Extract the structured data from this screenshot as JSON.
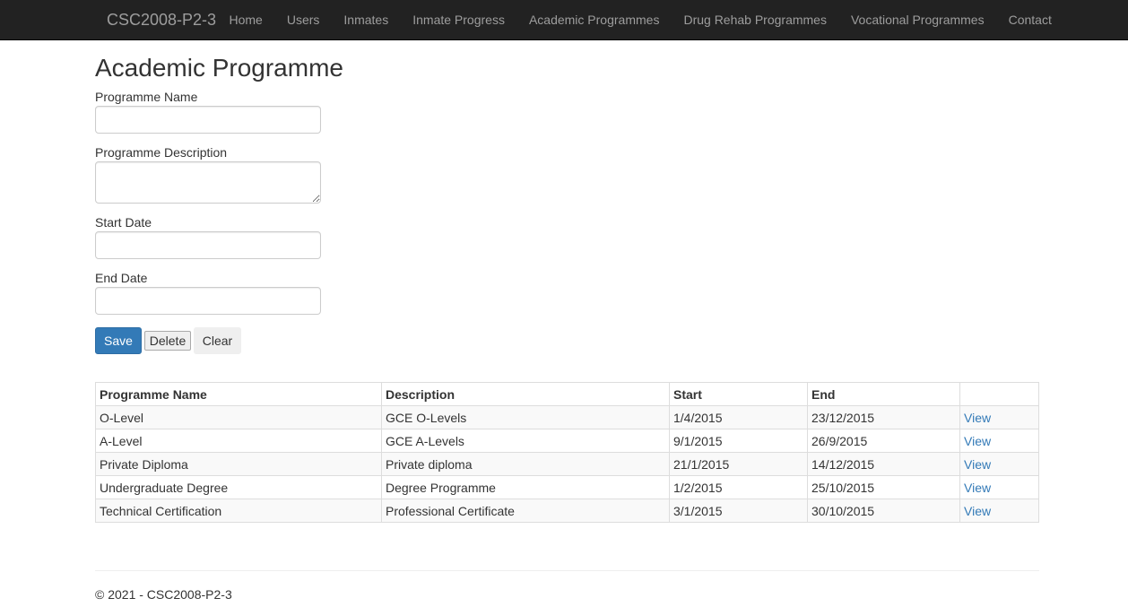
{
  "navbar": {
    "brand": "CSC2008-P2-3",
    "items": [
      {
        "label": "Home"
      },
      {
        "label": "Users"
      },
      {
        "label": "Inmates"
      },
      {
        "label": "Inmate Progress"
      },
      {
        "label": "Academic Programmes"
      },
      {
        "label": "Drug Rehab Programmes"
      },
      {
        "label": "Vocational Programmes"
      },
      {
        "label": "Contact"
      }
    ]
  },
  "page": {
    "title": "Academic Programme"
  },
  "form": {
    "name_label": "Programme Name",
    "name_value": "",
    "description_label": "Programme Description",
    "description_value": "",
    "start_label": "Start Date",
    "start_value": "",
    "end_label": "End Date",
    "end_value": "",
    "save_label": "Save",
    "delete_label": "Delete",
    "clear_label": "Clear"
  },
  "table": {
    "headers": [
      "Programme Name",
      "Description",
      "Start",
      "End",
      ""
    ],
    "rows": [
      {
        "name": "O-Level",
        "description": "GCE O-Levels",
        "start": "1/4/2015",
        "end": "23/12/2015",
        "action": "View"
      },
      {
        "name": "A-Level",
        "description": "GCE A-Levels",
        "start": "9/1/2015",
        "end": "26/9/2015",
        "action": "View"
      },
      {
        "name": "Private Diploma",
        "description": "Private diploma",
        "start": "21/1/2015",
        "end": "14/12/2015",
        "action": "View"
      },
      {
        "name": "Undergraduate Degree",
        "description": "Degree Programme",
        "start": "1/2/2015",
        "end": "25/10/2015",
        "action": "View"
      },
      {
        "name": "Technical Certification",
        "description": "Professional Certificate",
        "start": "3/1/2015",
        "end": "30/10/2015",
        "action": "View"
      }
    ]
  },
  "footer": {
    "text": "© 2021 - CSC2008-P2-3"
  },
  "colors": {
    "navbar_bg": "#222222",
    "nav_text": "#9d9d9d",
    "primary": "#337ab7",
    "link": "#337ab7"
  }
}
